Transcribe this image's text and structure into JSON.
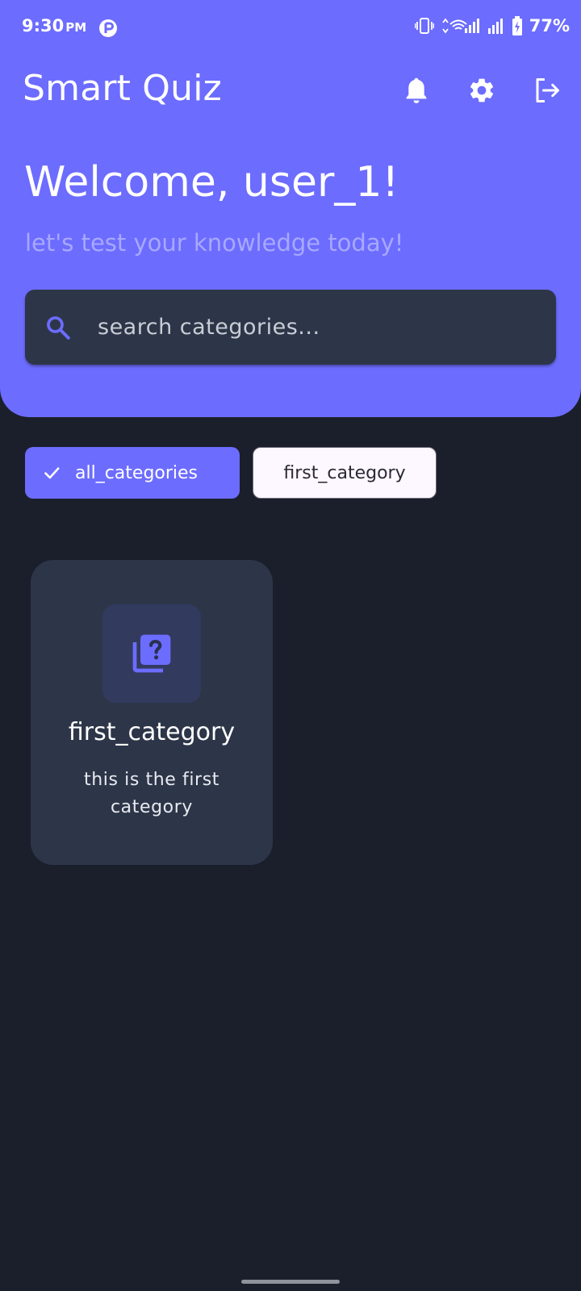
{
  "status_bar": {
    "time": "9:30",
    "ampm": "PM",
    "battery": "77%"
  },
  "app_bar": {
    "title": "Smart Quiz",
    "icons": [
      "bell-icon",
      "gear-icon",
      "logout-icon"
    ]
  },
  "welcome": {
    "title": "Welcome, user_1!",
    "subtitle": "let's test your knowledge today!"
  },
  "search": {
    "placeholder": "search categories..."
  },
  "filters": [
    {
      "label": "all_categories",
      "selected": true
    },
    {
      "label": "first_category",
      "selected": false
    }
  ],
  "categories": [
    {
      "title": "first_category",
      "description": "this is the first category",
      "icon": "quiz-icon"
    }
  ],
  "colors": {
    "accent": "#6c6cff",
    "background": "#1b1f2b",
    "card": "#2d3648",
    "subtitle": "#a8a8ff"
  }
}
